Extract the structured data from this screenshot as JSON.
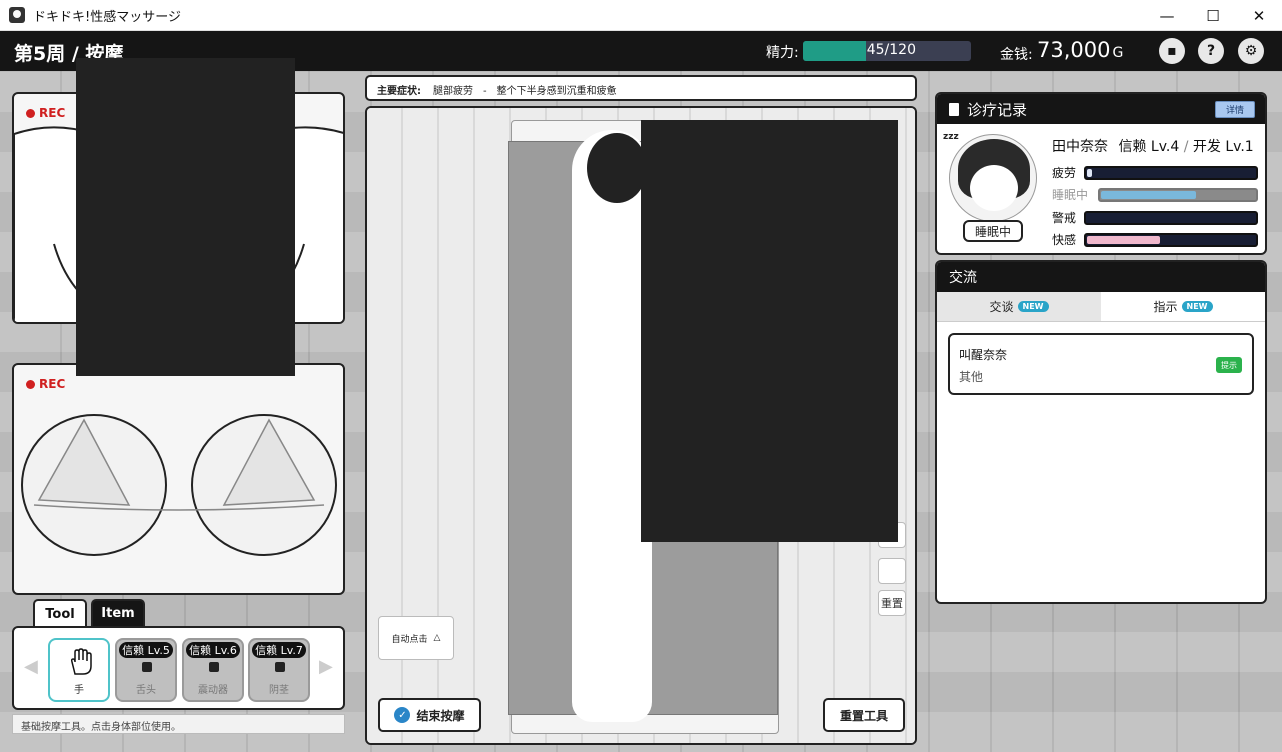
{
  "window": {
    "title": "ドキドキ!性感マッサージ",
    "minimize": "—",
    "maximize": "☐",
    "close": "✕"
  },
  "topbar": {
    "week_title": "第5周 / 按摩",
    "stamina_label": "精力:",
    "stamina_text": "45/120",
    "stamina_current": 45,
    "stamina_max": 120,
    "money_label": "金钱:",
    "money_value": "73,000",
    "money_unit": "G",
    "icons": [
      "chat-icon",
      "help-icon",
      "gear-icon"
    ],
    "chat_glyph": "▪",
    "help_glyph": "?",
    "gear_glyph": "⚙"
  },
  "cameras": [
    {
      "rec_label": "REC"
    },
    {
      "rec_label": "REC"
    }
  ],
  "tools": {
    "tabs": [
      "Tool",
      "Item"
    ],
    "items": [
      {
        "name": "手",
        "locked": false,
        "badge": ""
      },
      {
        "name": "舌头",
        "locked": true,
        "badge": "信赖 Lv.5"
      },
      {
        "name": "震动器",
        "locked": true,
        "badge": "信赖 Lv.6"
      },
      {
        "name": "阴茎",
        "locked": true,
        "badge": "信赖 Lv.7"
      }
    ],
    "hint": "基础按摩工具。点击身体部位使用。",
    "prev_arrow": "◀",
    "next_arrow": "▶"
  },
  "main": {
    "symptom_label": "主要症状:",
    "symptom_area": "腿部疲劳",
    "symptom_sep": "-",
    "symptom_desc": "整个下半身感到沉重和疲惫",
    "side_buttons": {
      "percent": "%",
      "reset": "重置"
    },
    "auto_click_label": "自动点击",
    "auto_click_icon": "△",
    "end_button": "结束按摩",
    "end_icon": "✓",
    "reset_tools_button": "重置工具"
  },
  "records": {
    "title": "诊疗记录",
    "detail_button": "详情",
    "zzz": "zzz",
    "status_badge": "睡眠中",
    "name": "田中奈奈",
    "trust": "信赖 Lv.4",
    "divider": "/",
    "develop": "开发 Lv.1",
    "stats": [
      {
        "label": "疲劳",
        "value": 0.04,
        "color": "#dfe6f5"
      },
      {
        "label": "睡眠中",
        "value": 0.62,
        "color": "#7ab8dc"
      },
      {
        "label": "警戒",
        "value": 0.0,
        "color": "#dfe6f5"
      },
      {
        "label": "快感",
        "value": 0.44,
        "color": "#f0b8cc"
      }
    ]
  },
  "exchange": {
    "title": "交流",
    "tabs": [
      {
        "label": "交谈",
        "badge": "NEW",
        "active": true
      },
      {
        "label": "指示",
        "badge": "NEW",
        "active": false
      }
    ],
    "items": [
      {
        "title": "叫醒奈奈",
        "subtitle": "其他",
        "badge": "提示"
      }
    ]
  }
}
